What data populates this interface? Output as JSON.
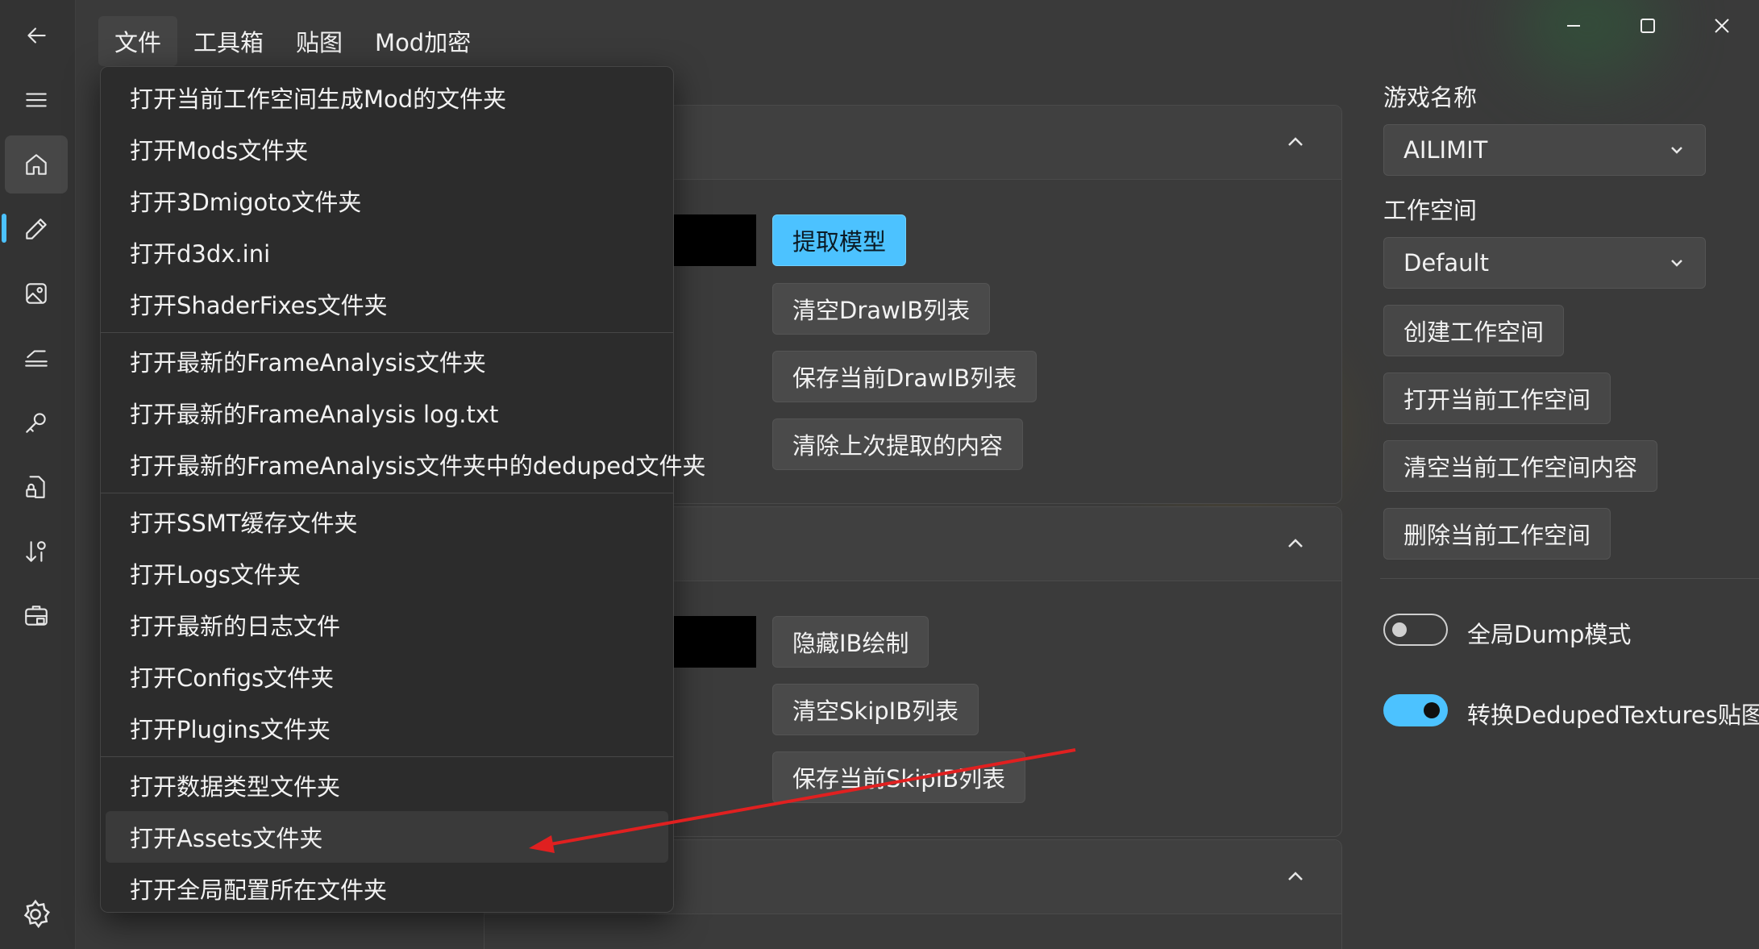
{
  "menubar": {
    "items": [
      {
        "label": "文件"
      },
      {
        "label": "工具箱"
      },
      {
        "label": "贴图"
      },
      {
        "label": "Mod加密"
      }
    ]
  },
  "file_menu": {
    "groups": [
      [
        "打开当前工作空间生成Mod的文件夹",
        "打开Mods文件夹",
        "打开3Dmigoto文件夹",
        "打开d3dx.ini",
        "打开ShaderFixes文件夹"
      ],
      [
        "打开最新的FrameAnalysis文件夹",
        "打开最新的FrameAnalysis log.txt",
        "打开最新的FrameAnalysis文件夹中的deduped文件夹"
      ],
      [
        "打开SSMT缓存文件夹",
        "打开Logs文件夹",
        "打开最新的日志文件",
        "打开Configs文件夹",
        "打开Plugins文件夹"
      ],
      [
        "打开数据类型文件夹",
        "打开Assets文件夹",
        "打开全局配置所在文件夹"
      ]
    ],
    "hovered_item": "打开Assets文件夹"
  },
  "section1": {
    "buttons": {
      "extract_model": "提取模型",
      "clear_drawib": "清空DrawIB列表",
      "save_drawib": "保存当前DrawIB列表",
      "clear_last": "清除上次提取的内容"
    }
  },
  "section2": {
    "buttons": {
      "hide_ib": "隐藏IB绘制",
      "clear_skipib": "清空SkipIB列表",
      "save_skipib": "保存当前SkipIB列表"
    }
  },
  "right_panel": {
    "game_name_label": "游戏名称",
    "game_name_value": "AILIMIT",
    "workspace_label": "工作空间",
    "workspace_value": "Default",
    "create_workspace": "创建工作空间",
    "open_workspace": "打开当前工作空间",
    "clear_workspace": "清空当前工作空间内容",
    "delete_workspace": "删除当前工作空间",
    "toggle_global_dump": {
      "label": "全局Dump模式",
      "on": false
    },
    "toggle_convert_textures": {
      "label": "转换DedupedTextures贴图",
      "on": true
    }
  },
  "colors": {
    "accent": "#4cc2ff",
    "annotation_arrow": "#e02020"
  },
  "icons": [
    "back-arrow-icon",
    "hamburger-icon",
    "home-icon",
    "pencil-icon",
    "image-icon",
    "layers-icon",
    "key-icon",
    "file-lock-icon",
    "sort-icon",
    "toolbox-icon",
    "gear-icon"
  ]
}
